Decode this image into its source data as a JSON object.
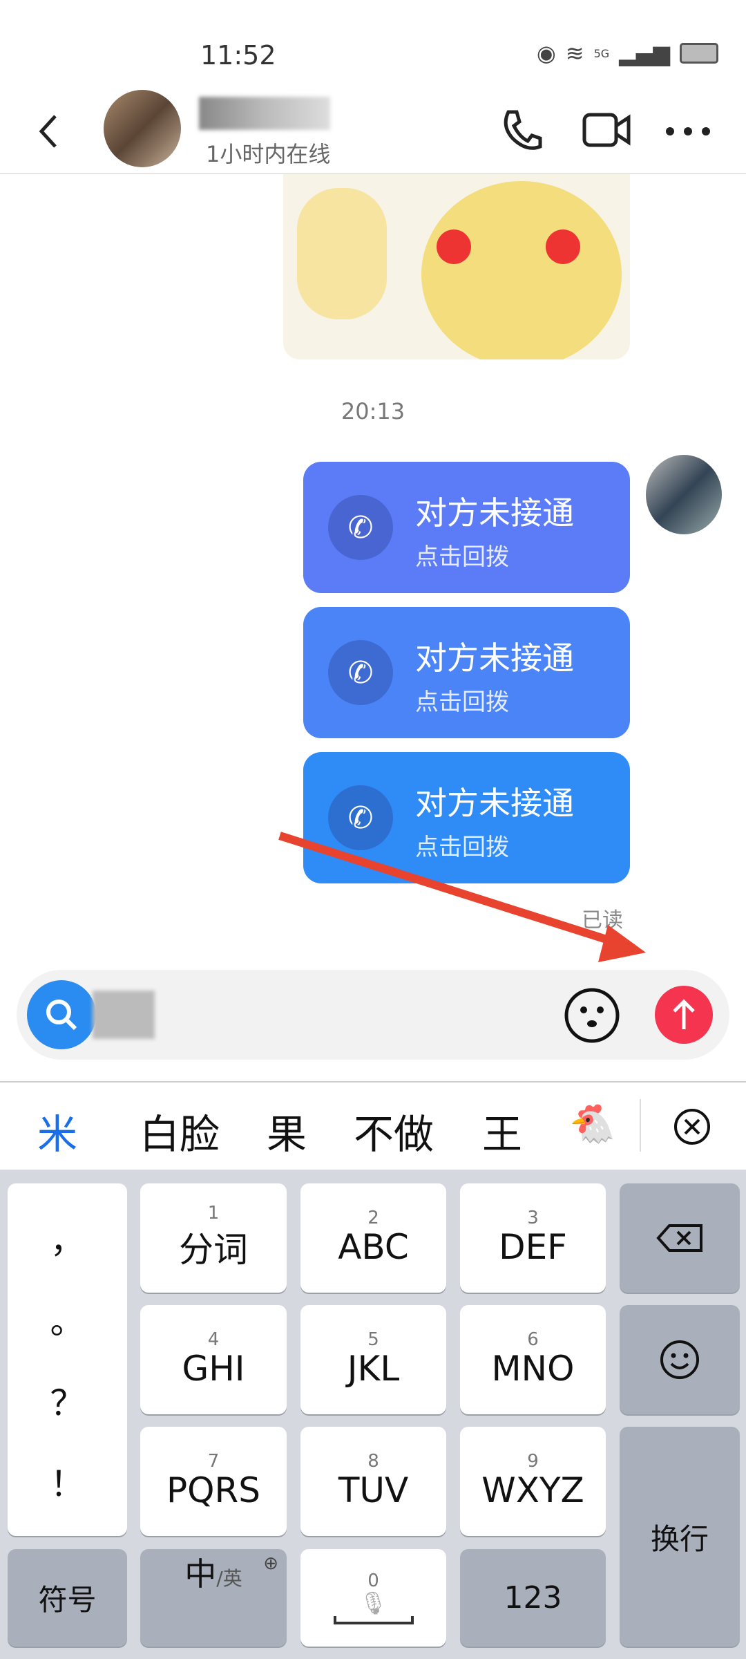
{
  "status": {
    "time": "11:52",
    "network": "5G"
  },
  "header": {
    "online_status": "1小时内在线"
  },
  "chat": {
    "timestamp": "20:13",
    "messages": [
      {
        "title": "对方未接通",
        "subtitle": "点击回拨"
      },
      {
        "title": "对方未接通",
        "subtitle": "点击回拨"
      },
      {
        "title": "对方未接通",
        "subtitle": "点击回拨"
      }
    ],
    "read_receipt": "已读",
    "bubble_colors": [
      "#5b7cf6",
      "#4a84f6",
      "#2f8bf6"
    ]
  },
  "input": {
    "send_color": "#f5344f",
    "search_color": "#2a8cf0"
  },
  "candidates": [
    "米",
    "白脸",
    "果",
    "不做",
    "王",
    "🐔"
  ],
  "keyboard": {
    "punct": [
      "，",
      "。",
      "？",
      "！"
    ],
    "keys": [
      {
        "num": "1",
        "label": "分词"
      },
      {
        "num": "2",
        "label": "ABC"
      },
      {
        "num": "3",
        "label": "DEF"
      },
      {
        "num": "4",
        "label": "GHI"
      },
      {
        "num": "5",
        "label": "JKL"
      },
      {
        "num": "6",
        "label": "MNO"
      },
      {
        "num": "7",
        "label": "PQRS"
      },
      {
        "num": "8",
        "label": "TUV"
      },
      {
        "num": "9",
        "label": "WXYZ"
      }
    ],
    "symbols": "符号",
    "lang_main": "中",
    "lang_alt": "/英",
    "space_num": "0",
    "numbers": "123",
    "enter": "换行"
  }
}
